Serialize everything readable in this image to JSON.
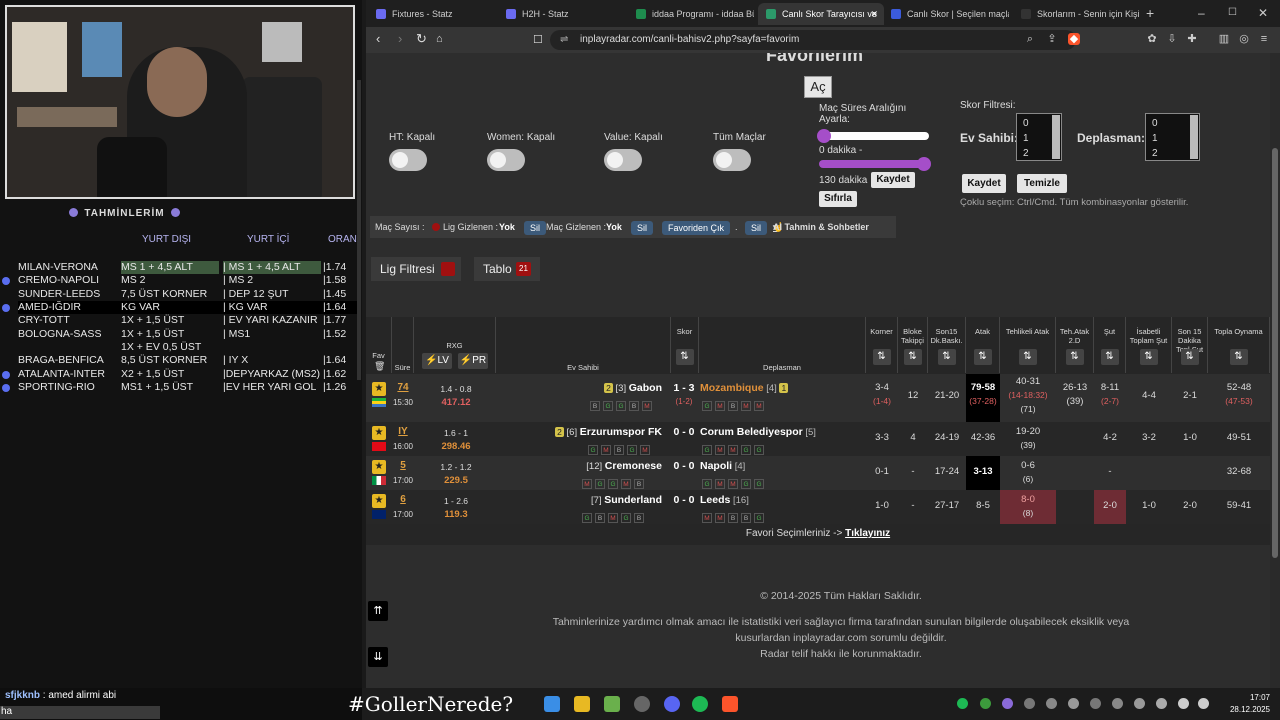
{
  "left_panel": {
    "title": "TAHMİNLERİM",
    "col_headers": {
      "yurt_disi": "YURT DIŞI",
      "yurt_ici": "YURT İÇİ",
      "oran": "ORAN"
    },
    "rows": [
      {
        "match": "MILAN-VERONA",
        "yurt_disi": "MS 1 + 4,5 ALT",
        "yurt_ici": "| MS 1 + 4,5 ALT",
        "oran": "|1.74",
        "highlight": true,
        "bullet": false,
        "selected": false
      },
      {
        "match": "CREMO-NAPOLI",
        "yurt_disi": "MS 2",
        "yurt_ici": "| MS 2",
        "oran": "|1.58",
        "highlight": false,
        "bullet": true,
        "selected": false
      },
      {
        "match": "SUNDER-LEEDS",
        "yurt_disi": "7,5 ÜST KORNER",
        "yurt_ici": "| DEP 12 ŞUT",
        "oran": "|1.45",
        "highlight": false,
        "bullet": false,
        "selected": false
      },
      {
        "match": "AMED-IĞDIR",
        "yurt_disi": "KG VAR",
        "yurt_ici": "| KG VAR",
        "oran": "|1.64",
        "highlight": false,
        "bullet": true,
        "selected": true
      },
      {
        "match": "CRY-TOTT",
        "yurt_disi": "1X + 1,5 ÜST",
        "yurt_ici": "| EV YARI KAZANIR",
        "oran": "|1.77",
        "highlight": false,
        "bullet": false,
        "selected": false
      },
      {
        "match": "BOLOGNA-SASS",
        "yurt_disi": "1X + 1,5 ÜST",
        "yurt_ici": "| MS1",
        "oran": "|1.52",
        "highlight": false,
        "bullet": false,
        "selected": false
      },
      {
        "match": "",
        "yurt_disi": "1X + EV 0,5 ÜST",
        "yurt_ici": "",
        "oran": "",
        "highlight": false,
        "bullet": false,
        "selected": false
      },
      {
        "match": "BRAGA-BENFICA",
        "yurt_disi": "8,5 ÜST KORNER",
        "yurt_ici": "| IY X",
        "oran": "|1.64",
        "highlight": false,
        "bullet": false,
        "selected": false
      },
      {
        "match": "ATALANTA-INTER",
        "yurt_disi": "X2 + 1,5 ÜST",
        "yurt_ici": "|DEPYARKAZ (MS2)",
        "oran": "|1.62",
        "highlight": false,
        "bullet": true,
        "selected": false
      },
      {
        "match": "SPORTING-RIO",
        "yurt_disi": "MS1 + 1,5 ÜST",
        "yurt_ici": "|EV HER YARI GOL",
        "oran": "|1.26",
        "highlight": false,
        "bullet": true,
        "selected": false
      }
    ],
    "chat": {
      "user": "sfjkknb",
      "message": ": amed alirmi abi",
      "line2": "ha"
    }
  },
  "browser": {
    "tabs": [
      {
        "label": "Fixtures - Statz",
        "color": "#6a6af0",
        "active": false
      },
      {
        "label": "H2H - Statz",
        "color": "#6a6af0",
        "active": false
      },
      {
        "label": "iddaa Programı - iddaa Bü",
        "color": "#1e8c4e",
        "active": false
      },
      {
        "label": "Canlı Skor Tarayıcısı ve",
        "color": "#2c9a6a",
        "active": true
      },
      {
        "label": "Canlı Skor | Seçilen maçlar",
        "color": "#3b5bdb",
        "active": false
      },
      {
        "label": "Skorlarım - Senin için Kişis",
        "color": "#333333",
        "active": false
      }
    ],
    "url": "inplayradar.com/canli-bahisv2.php?sayfa=favorim"
  },
  "page": {
    "title": "Favorilerim",
    "open_button": "Aç",
    "toggles": [
      {
        "label": "HT: Kapalı"
      },
      {
        "label": "Women: Kapalı"
      },
      {
        "label": "Value: Kapalı"
      },
      {
        "label": "Tüm Maçlar"
      }
    ],
    "match_time": {
      "label1": "Maç Süres Aralığını",
      "label2": "Ayarla:",
      "min_text": "0 dakika -",
      "max_text": "130 dakika",
      "save": "Kaydet",
      "reset": "Sıfırla"
    },
    "score_filter": {
      "label": "Skor Filtresi:",
      "home": "Ev Sahibi:",
      "away": "Deplasman:",
      "options": [
        "0",
        "1",
        "2"
      ],
      "save": "Kaydet",
      "clear": "Temizle",
      "hint": "Çoklu seçim: Ctrl/Cmd. Tüm kombinasyonlar gösterilir."
    },
    "bar": {
      "mac_sayisi": "Maç Sayısı :",
      "lig_gizlenen": "Lig Gizlenen :",
      "yok1": "Yok",
      "sil1": "Sil",
      "mac_gizlenen": "Maç Gizlenen :",
      "yok2": "Yok",
      "sil2": "Sil",
      "favoriden": "Favoriden Çık",
      "dot": ".",
      "sil3": "Sil",
      "ai": "AI Tahmin & Sohbetler"
    },
    "lig_filtresi": "Lig Filtresi",
    "tablo": "Tablo",
    "tablo_badge": "21",
    "headers": {
      "fav": "Fav",
      "sure": "Süre",
      "rxg": "RXG",
      "lv": "LV",
      "pr": "PR",
      "ev": "Ev Sahibi",
      "skor": "Skor",
      "dep": "Deplasman",
      "korner": "Korner",
      "bloke": "Bloke Takipçi",
      "son15": "Son15 Dk.Baskı.",
      "atak": "Atak",
      "tehlikeli": "Tehlikeli Atak",
      "tehatak": "Teh.Atak 2.D",
      "sut": "Şut",
      "isabetli": "İsabetli Toplam Şut",
      "son15sut": "Son 15 Dakika Topl.Şut",
      "topla": "Topla Oynama"
    },
    "matches": [
      {
        "min": "74",
        "time": "15:30",
        "rxg": "1.4 - 0.8",
        "val": "417.12",
        "home_rank": "[3]",
        "home_card": "2",
        "home": "Gabon",
        "score": "1 - 3",
        "ht": "(1-2)",
        "away": "Mozambique",
        "away_rank": "[4]",
        "away_card": "1",
        "home_form": [
          "B",
          "G",
          "G",
          "B",
          "M"
        ],
        "away_form": [
          "G",
          "M",
          "B",
          "M",
          "M"
        ],
        "korner": "3-4",
        "korner_ht": "(1-4)",
        "bloke": "12",
        "son15": "21-20",
        "atak": "79-58",
        "atak_ht": "(37-28)",
        "tehlikeli": "40-31",
        "tehlikeli_ht": "(14-18:32)",
        "tehlikeli_ht2": "(71)",
        "tehatak": "26-13",
        "tehatak_ht": "(39)",
        "sut": "8-11",
        "sut_ht": "(2-7)",
        "isabetli": "4-4",
        "son15sut": "2-1",
        "topla": "52-48",
        "topla_ht": "(47-53)"
      },
      {
        "min": "IY",
        "time": "16:00",
        "rxg": "1.6 - 1",
        "val": "298.46",
        "home_rank": "[6]",
        "home_card": "2",
        "home": "Erzurumspor FK",
        "score": "0 - 0",
        "ht": "",
        "away": "Corum Belediyespor",
        "away_rank": "[5]",
        "away_card": "",
        "home_form": [
          "G",
          "M",
          "B",
          "G",
          "M"
        ],
        "away_form": [
          "G",
          "M",
          "M",
          "G",
          "G"
        ],
        "korner": "3-3",
        "korner_ht": "",
        "bloke": "4",
        "son15": "24-19",
        "atak": "42-36",
        "atak_ht": "",
        "tehlikeli": "19-20",
        "tehlikeli_ht": "(39)",
        "tehlikeli_ht2": "",
        "tehatak": "",
        "tehatak_ht": "",
        "sut": "4-2",
        "sut_ht": "",
        "isabetli": "3-2",
        "son15sut": "1-0",
        "topla": "49-51",
        "topla_ht": ""
      },
      {
        "min": "5",
        "time": "17:00",
        "rxg": "1.2 - 1.2",
        "val": "229.5",
        "home_rank": "[12]",
        "home_card": "",
        "home": "Cremonese",
        "score": "0 - 0",
        "ht": "",
        "away": "Napoli",
        "away_rank": "[4]",
        "away_card": "",
        "home_form": [
          "M",
          "G",
          "G",
          "M",
          "B"
        ],
        "away_form": [
          "G",
          "M",
          "M",
          "G",
          "G"
        ],
        "korner": "0-1",
        "korner_ht": "",
        "bloke": "-",
        "son15": "17-24",
        "atak": "3-13",
        "atak_ht": "",
        "tehlikeli": "0-6",
        "tehlikeli_ht": "(6)",
        "tehlikeli_ht2": "",
        "tehatak": "",
        "tehatak_ht": "",
        "sut": "-",
        "sut_ht": "",
        "isabetli": "",
        "son15sut": "",
        "topla": "32-68",
        "topla_ht": ""
      },
      {
        "min": "6",
        "time": "17:00",
        "rxg": "1 - 2.6",
        "val": "119.3",
        "home_rank": "[7]",
        "home_card": "",
        "home": "Sunderland",
        "score": "0 - 0",
        "ht": "",
        "away": "Leeds",
        "away_rank": "[16]",
        "away_card": "",
        "home_form": [
          "G",
          "B",
          "M",
          "G",
          "B"
        ],
        "away_form": [
          "M",
          "M",
          "B",
          "B",
          "G"
        ],
        "korner": "1-0",
        "korner_ht": "",
        "bloke": "-",
        "son15": "27-17",
        "atak": "8-5",
        "atak_ht": "",
        "tehlikeli": "8-0",
        "tehlikeli_ht": "(8)",
        "tehlikeli_ht2": "",
        "tehatak": "",
        "tehatak_ht": "",
        "sut": "2-0",
        "sut_ht": "",
        "isabetli": "1-0",
        "son15sut": "2-0",
        "topla": "59-41",
        "topla_ht": ""
      }
    ],
    "fav_selection": "Favori Seçimleriniz ->",
    "fav_link": "Tıklayınız",
    "footer": [
      "© 2014-2025 Tüm Hakları Saklıdır.",
      "Tahminlerinize yardımcı olmak amacı ile istatistiki veri sağlayıcı firma tarafından sunulan bilgilerde oluşabilecek eksiklik veya",
      "kusurlardan inplayradar.com sorumlu değildir.",
      "Radar telif hakkı ile korunmaktadır."
    ]
  },
  "taskbar": {
    "overlay": "#GollerNerede?",
    "time": "17:07",
    "date": "28.12.2025"
  }
}
